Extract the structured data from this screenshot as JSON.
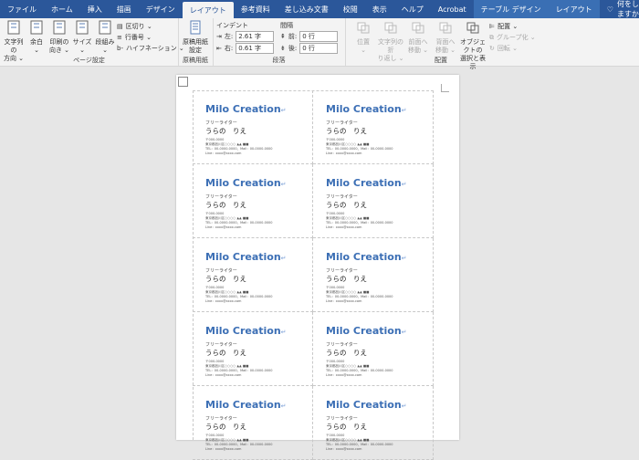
{
  "tabs": [
    "ファイル",
    "ホーム",
    "挿入",
    "描画",
    "デザイン",
    "レイアウト",
    "参考資料",
    "差し込み文書",
    "校閲",
    "表示",
    "ヘルプ",
    "Acrobat",
    "テーブル デザイン",
    "レイアウト"
  ],
  "active_tab": 5,
  "tell_me": "何をしますか",
  "ribbon": {
    "page_setup": {
      "label": "ページ設定",
      "buttons": [
        {
          "l1": "文字列の",
          "l2": "方向 ⌄"
        },
        {
          "l1": "余白",
          "l2": "⌄"
        },
        {
          "l1": "印刷の",
          "l2": "向き ⌄"
        },
        {
          "l1": "サイズ",
          "l2": "⌄"
        },
        {
          "l1": "段組み",
          "l2": "⌄"
        }
      ],
      "small": [
        "区切り ⌄",
        "行番号 ⌄",
        "ハイフネーション ⌄"
      ]
    },
    "genko": {
      "label": "原稿用紙",
      "btn1": "原稿用紙",
      "btn2": "設定"
    },
    "paragraph": {
      "label": "段落",
      "indent_label": "インデント",
      "spacing_label": "間隔",
      "left_label": "左:",
      "left_value": "2.61 字",
      "right_label": "右:",
      "right_value": "0.61 字",
      "before_label": "前:",
      "before_value": "0 行",
      "after_label": "後:",
      "after_value": "0 行"
    },
    "arrange": {
      "label": "配置",
      "buttons": [
        {
          "l1": "位置",
          "l2": "⌄"
        },
        {
          "l1": "文字列の折",
          "l2": "り返し ⌄"
        },
        {
          "l1": "前面へ",
          "l2": "移動 ⌄"
        },
        {
          "l1": "背面へ",
          "l2": "移動 ⌄"
        },
        {
          "l1": "オブジェクトの",
          "l2": "選択と表示"
        }
      ],
      "small": [
        "配置 ⌄",
        "グループ化 ⌄",
        "回転 ⌄"
      ]
    }
  },
  "card": {
    "title": "Milo Creation",
    "role": "フリーライター",
    "name": "うらの　りえ",
    "info1": "〒000-0000",
    "info2": "東京都品川区○○○○ ▲▲ ■■",
    "info3": "TEL：00-0000-0000、Mail：00-0000-0000",
    "info4": "Line：xxxx@xxxx.com"
  },
  "card_count": 10,
  "colors": {
    "ribbon_blue": "#2b579a",
    "title_blue": "#3c6fb5"
  }
}
